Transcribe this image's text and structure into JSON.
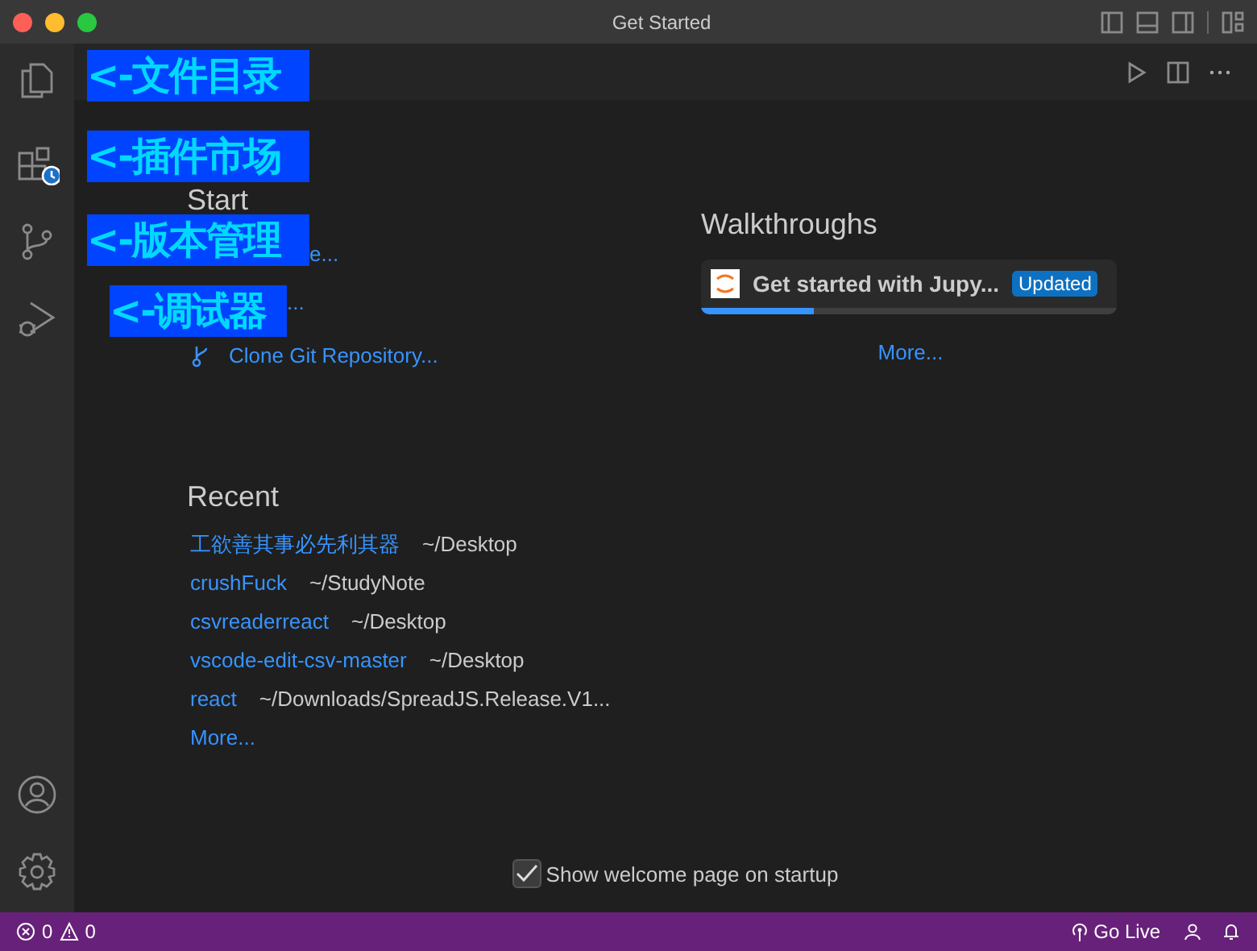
{
  "window": {
    "title": "Get Started"
  },
  "annotations": [
    {
      "text": "<-文件目录"
    },
    {
      "text": "<-插件市场"
    },
    {
      "text": "<-版本管理"
    },
    {
      "text": "<-调试器"
    }
  ],
  "start": {
    "heading": "Start",
    "items": [
      {
        "label": "e..."
      },
      {
        "label": "..."
      },
      {
        "label": "Clone Git Repository..."
      }
    ]
  },
  "recent": {
    "heading": "Recent",
    "items": [
      {
        "name": "工欲善其事必先利其器",
        "path": "~/Desktop"
      },
      {
        "name": "crushFuck",
        "path": "~/StudyNote"
      },
      {
        "name": "csvreaderreact",
        "path": "~/Desktop"
      },
      {
        "name": "vscode-edit-csv-master",
        "path": "~/Desktop"
      },
      {
        "name": "react",
        "path": "~/Downloads/SpreadJS.Release.V1..."
      }
    ],
    "more": "More..."
  },
  "walkthroughs": {
    "heading": "Walkthroughs",
    "items": [
      {
        "title": "Get started with Jupy...",
        "badge": "Updated",
        "level": 0.27
      }
    ],
    "more": "More..."
  },
  "show_on_startup": {
    "label": "Show welcome page on startup",
    "checked": true
  },
  "status_bar": {
    "errors": "0",
    "warnings": "0",
    "go_live": "Go Live"
  }
}
